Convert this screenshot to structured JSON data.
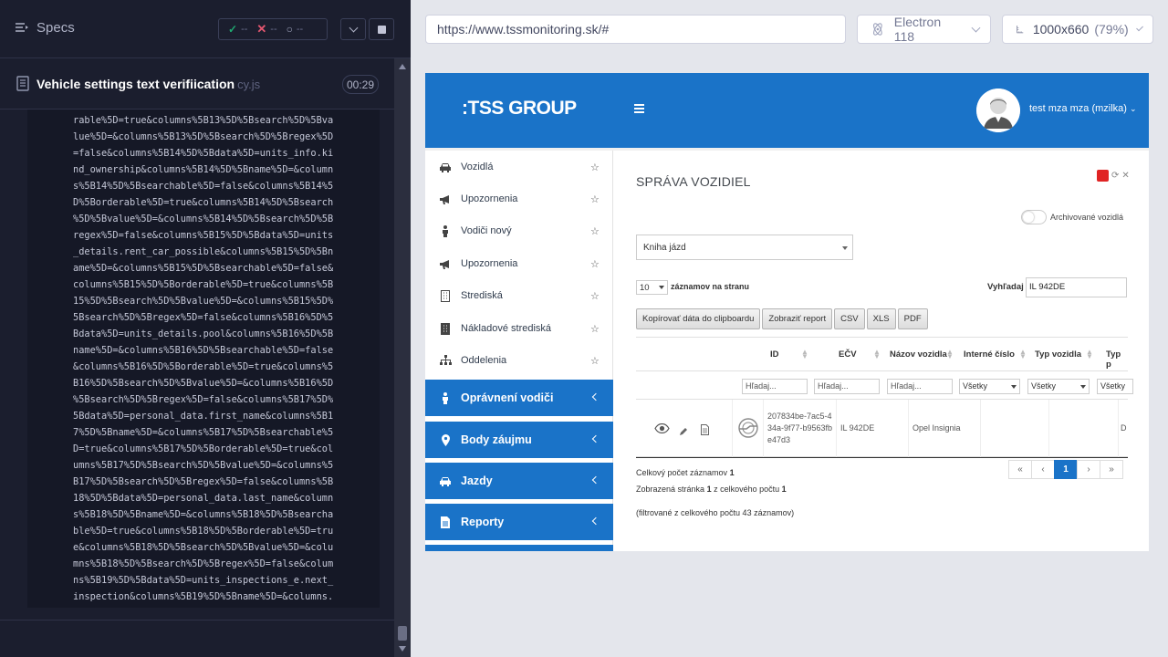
{
  "runner": {
    "specs_label": "Specs",
    "stats": {
      "passed": "--",
      "failed": "--",
      "pending": "--"
    },
    "test_title": "Vehicle settings text verifiication",
    "test_file": "cy.js",
    "duration": "00:29",
    "log_lines": [
      "rable%5D=true&columns%5B13%5D%5Bsearch%5D%5Bva",
      "lue%5D=&columns%5B13%5D%5Bsearch%5D%5Bregex%5D",
      "=false&columns%5B14%5D%5Bdata%5D=units_info.ki",
      "nd_ownership&columns%5B14%5D%5Bname%5D=&column",
      "s%5B14%5D%5Bsearchable%5D=false&columns%5B14%5",
      "D%5Borderable%5D=true&columns%5B14%5D%5Bsearch",
      "%5D%5Bvalue%5D=&columns%5B14%5D%5Bsearch%5D%5B",
      "regex%5D=false&columns%5B15%5D%5Bdata%5D=units",
      "_details.rent_car_possible&columns%5B15%5D%5Bn",
      "ame%5D=&columns%5B15%5D%5Bsearchable%5D=false&",
      "columns%5B15%5D%5Borderable%5D=true&columns%5B",
      "15%5D%5Bsearch%5D%5Bvalue%5D=&columns%5B15%5D%",
      "5Bsearch%5D%5Bregex%5D=false&columns%5B16%5D%5",
      "Bdata%5D=units_details.pool&columns%5B16%5D%5B",
      "name%5D=&columns%5B16%5D%5Bsearchable%5D=false",
      "&columns%5B16%5D%5Borderable%5D=true&columns%5",
      "B16%5D%5Bsearch%5D%5Bvalue%5D=&columns%5B16%5D",
      "%5Bsearch%5D%5Bregex%5D=false&columns%5B17%5D%",
      "5Bdata%5D=personal_data.first_name&columns%5B1",
      "7%5D%5Bname%5D=&columns%5B17%5D%5Bsearchable%5",
      "D=true&columns%5B17%5D%5Borderable%5D=true&col",
      "umns%5B17%5D%5Bsearch%5D%5Bvalue%5D=&columns%5",
      "B17%5D%5Bsearch%5D%5Bregex%5D=false&columns%5B",
      "18%5D%5Bdata%5D=personal_data.last_name&column",
      "s%5B18%5D%5Bname%5D=&columns%5B18%5D%5Bsearcha",
      "ble%5D=true&columns%5B18%5D%5Borderable%5D=tru",
      "e&columns%5B18%5D%5Bsearch%5D%5Bvalue%5D=&colu",
      "mns%5B18%5D%5Bsearch%5D%5Bregex%5D=false&colum",
      "ns%5B19%5D%5Bdata%5D=units_inspections_e.next_",
      "inspection&columns%5B19%5D%5Bname%5D=&columns."
    ]
  },
  "topbar": {
    "url": "https://www.tssmonitoring.sk/#",
    "browser": "Electron 118",
    "viewport": "1000x660",
    "zoom": "(79%)"
  },
  "app": {
    "brand": ":TSS GROUP",
    "user": "test mza mza (mzilka)",
    "menu_items": [
      {
        "label": "Vozidlá",
        "icon": "car-icon"
      },
      {
        "label": "Upozornenia",
        "icon": "megaphone-icon"
      },
      {
        "label": "Vodiči nový",
        "icon": "person-icon"
      },
      {
        "label": "Upozornenia",
        "icon": "megaphone-icon"
      },
      {
        "label": "Strediská",
        "icon": "building-icon"
      },
      {
        "label": "Nákladové strediská",
        "icon": "building-icon"
      },
      {
        "label": "Oddelenia",
        "icon": "sitemap-icon"
      }
    ],
    "menu_groups": [
      {
        "label": "Oprávnení vodiči",
        "icon": "person-icon"
      },
      {
        "label": "Body záujmu",
        "icon": "map-pin-icon"
      },
      {
        "label": "Jazdy",
        "icon": "car-icon"
      },
      {
        "label": "Reporty",
        "icon": "file-icon"
      }
    ],
    "page_title": "SPRÁVA VOZIDIEL",
    "archived_label": "Archivované vozidlá",
    "book_select": "Kniha jázd",
    "page_length": "10",
    "page_length_label": "záznamov na stranu",
    "search_label": "Vyhľadaj",
    "search_value": "IL 942DE",
    "buttons": [
      "Kopírovať dáta do clipboardu",
      "Zobraziť report",
      "CSV",
      "XLS",
      "PDF"
    ],
    "columns": [
      "ID",
      "EČV",
      "Názov vozidla",
      "Interné číslo",
      "Typ vozidla",
      "Typ p"
    ],
    "filters": {
      "text_placeholder": "Hľadaj...",
      "select_all": "Všetky"
    },
    "row": {
      "id": "207834be-7ac5-434a-9f77-b9563fbe47d3",
      "ecv": "IL 942DE",
      "name": "Opel Insignia",
      "last": "D"
    },
    "info": {
      "total_label": "Celkový počet záznamov",
      "total_value": "1",
      "page_prefix": "Zobrazená stránka",
      "page_value": "1",
      "page_mid": "z celkového počtu",
      "page_total": "1",
      "filtered": "(filtrované z celkového počtu 43 záznamov)"
    },
    "pager": [
      "«",
      "‹",
      "1",
      "›",
      "»"
    ]
  }
}
